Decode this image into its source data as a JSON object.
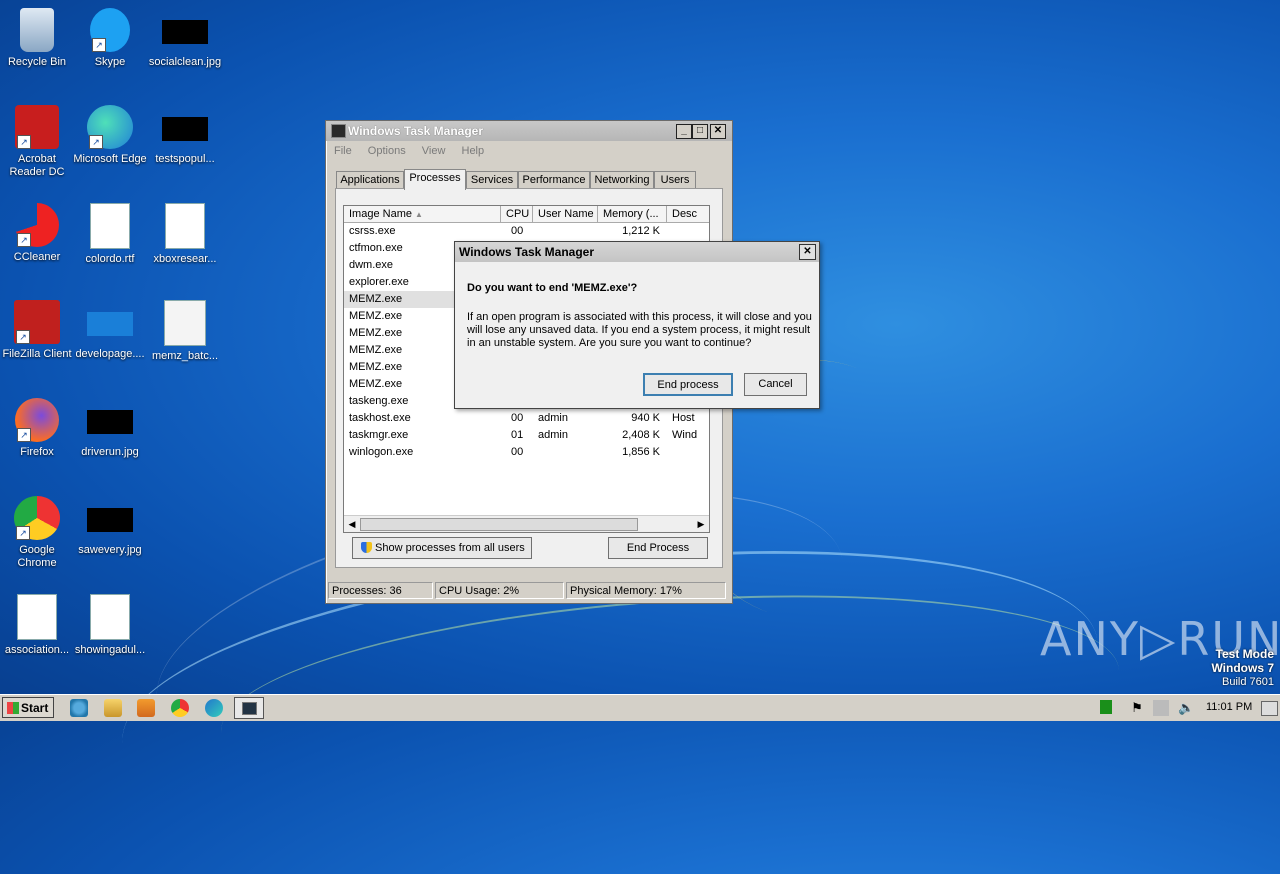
{
  "desktop_icons": [
    {
      "label": "Recycle Bin",
      "icon": "recycle-bin-icon"
    },
    {
      "label": "Skype",
      "icon": "skype-icon"
    },
    {
      "label": "socialclean.jpg",
      "icon": "image-file-icon"
    },
    {
      "label": "Acrobat Reader DC",
      "icon": "acrobat-icon"
    },
    {
      "label": "Microsoft Edge",
      "icon": "edge-icon"
    },
    {
      "label": "testspopul...",
      "icon": "image-file-icon"
    },
    {
      "label": "CCleaner",
      "icon": "ccleaner-icon"
    },
    {
      "label": "colordo.rtf",
      "icon": "word-doc-icon"
    },
    {
      "label": "xboxresear...",
      "icon": "word-doc-icon"
    },
    {
      "label": "FileZilla Client",
      "icon": "filezilla-icon"
    },
    {
      "label": "developage....",
      "icon": "image-file-icon"
    },
    {
      "label": "memz_batc...",
      "icon": "batch-file-icon"
    },
    {
      "label": "Firefox",
      "icon": "firefox-icon"
    },
    {
      "label": "driverun.jpg",
      "icon": "image-file-icon"
    },
    {
      "label": "Google Chrome",
      "icon": "chrome-icon"
    },
    {
      "label": "sawevery.jpg",
      "icon": "image-file-icon"
    },
    {
      "label": "association...",
      "icon": "word-doc-icon"
    },
    {
      "label": "showingadul...",
      "icon": "word-doc-icon"
    }
  ],
  "task_manager": {
    "title": "Windows Task Manager",
    "menu": [
      "File",
      "Options",
      "View",
      "Help"
    ],
    "tabs": [
      "Applications",
      "Processes",
      "Services",
      "Performance",
      "Networking",
      "Users"
    ],
    "active_tab": "Processes",
    "columns": [
      "Image Name",
      "CPU",
      "User Name",
      "Memory (...",
      "Desc"
    ],
    "rows": [
      {
        "name": "csrss.exe",
        "cpu": "00",
        "user": "",
        "mem": "1,212 K",
        "desc": ""
      },
      {
        "name": "ctfmon.exe",
        "cpu": "",
        "user": "",
        "mem": "",
        "desc": ""
      },
      {
        "name": "dwm.exe",
        "cpu": "",
        "user": "",
        "mem": "",
        "desc": ""
      },
      {
        "name": "explorer.exe",
        "cpu": "",
        "user": "",
        "mem": "",
        "desc": ""
      },
      {
        "name": "MEMZ.exe",
        "cpu": "",
        "user": "",
        "mem": "",
        "desc": ""
      },
      {
        "name": "MEMZ.exe",
        "cpu": "",
        "user": "",
        "mem": "",
        "desc": ""
      },
      {
        "name": "MEMZ.exe",
        "cpu": "",
        "user": "",
        "mem": "",
        "desc": ""
      },
      {
        "name": "MEMZ.exe",
        "cpu": "",
        "user": "",
        "mem": "",
        "desc": ""
      },
      {
        "name": "MEMZ.exe",
        "cpu": "",
        "user": "",
        "mem": "",
        "desc": ""
      },
      {
        "name": "MEMZ.exe",
        "cpu": "",
        "user": "",
        "mem": "",
        "desc": ""
      },
      {
        "name": "taskeng.exe",
        "cpu": "",
        "user": "",
        "mem": "",
        "desc": ""
      },
      {
        "name": "taskhost.exe",
        "cpu": "00",
        "user": "admin",
        "mem": "940 K",
        "desc": "Host"
      },
      {
        "name": "taskmgr.exe",
        "cpu": "01",
        "user": "admin",
        "mem": "2,408 K",
        "desc": "Wind"
      },
      {
        "name": "winlogon.exe",
        "cpu": "00",
        "user": "",
        "mem": "1,856 K",
        "desc": ""
      }
    ],
    "selected_row": 4,
    "show_all_label": "Show processes from all users",
    "end_process_label": "End Process",
    "status": {
      "processes": "Processes: 36",
      "cpu": "CPU Usage: 2%",
      "memory": "Physical Memory: 17%"
    }
  },
  "dialog": {
    "title": "Windows Task Manager",
    "question": "Do you want to end 'MEMZ.exe'?",
    "message": "If an open program is associated with this process, it will close and you will lose any unsaved data. If you end a system process, it might result in an unstable system. Are you sure you want to continue?",
    "confirm_label": "End process",
    "cancel_label": "Cancel"
  },
  "taskbar": {
    "start_label": "Start",
    "clock": "11:01 PM",
    "pinned": [
      "ie-icon",
      "explorer-icon",
      "media-player-icon",
      "chrome-icon",
      "edge-icon",
      "task-manager-icon"
    ]
  },
  "watermark": {
    "line1": "Test Mode",
    "line2": "Windows 7",
    "line3": "Build 7601",
    "brand": "ANY RUN"
  },
  "colors": {
    "desktop": "#1a6fd0",
    "window_face": "#d4d0c8",
    "selection": "#e0e0e0"
  }
}
